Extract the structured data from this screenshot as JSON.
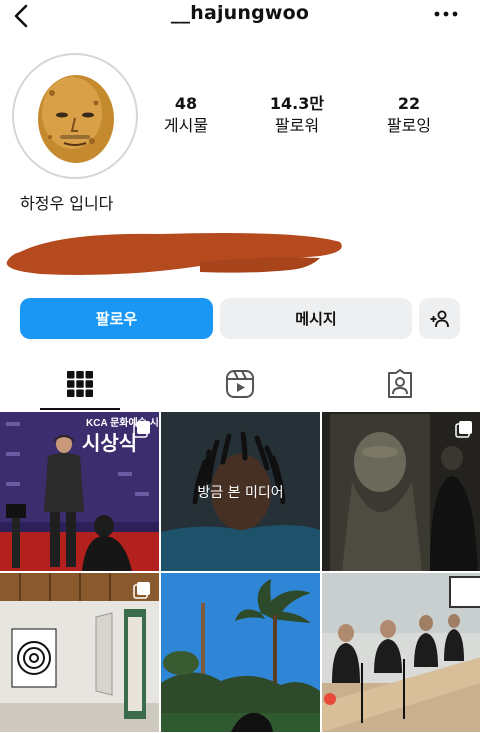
{
  "header": {
    "username": "__hajungwoo"
  },
  "profile": {
    "stats": {
      "posts": {
        "value": "48",
        "label": "게시물"
      },
      "followers": {
        "value": "14.3만",
        "label": "팔로워"
      },
      "following": {
        "value": "22",
        "label": "팔로잉"
      }
    },
    "bio": "하정우 입니다"
  },
  "actions": {
    "follow_label": "팔로우",
    "message_label": "메시지"
  },
  "tabs": [
    {
      "icon": "grid-icon",
      "active": true
    },
    {
      "icon": "reels-icon",
      "active": false
    },
    {
      "icon": "tagged-icon",
      "active": false
    }
  ],
  "posts": [
    {
      "index": 1,
      "poster_text": "KCA 문화예술 시상식",
      "multi": true
    },
    {
      "index": 2,
      "overlay": "방금 본 미디어"
    },
    {
      "index": 3,
      "multi": true
    },
    {
      "index": 4,
      "multi": true
    },
    {
      "index": 5
    },
    {
      "index": 6
    }
  ],
  "colors": {
    "primary": "#1a96f5",
    "secondary_bg": "#eeeff1"
  }
}
